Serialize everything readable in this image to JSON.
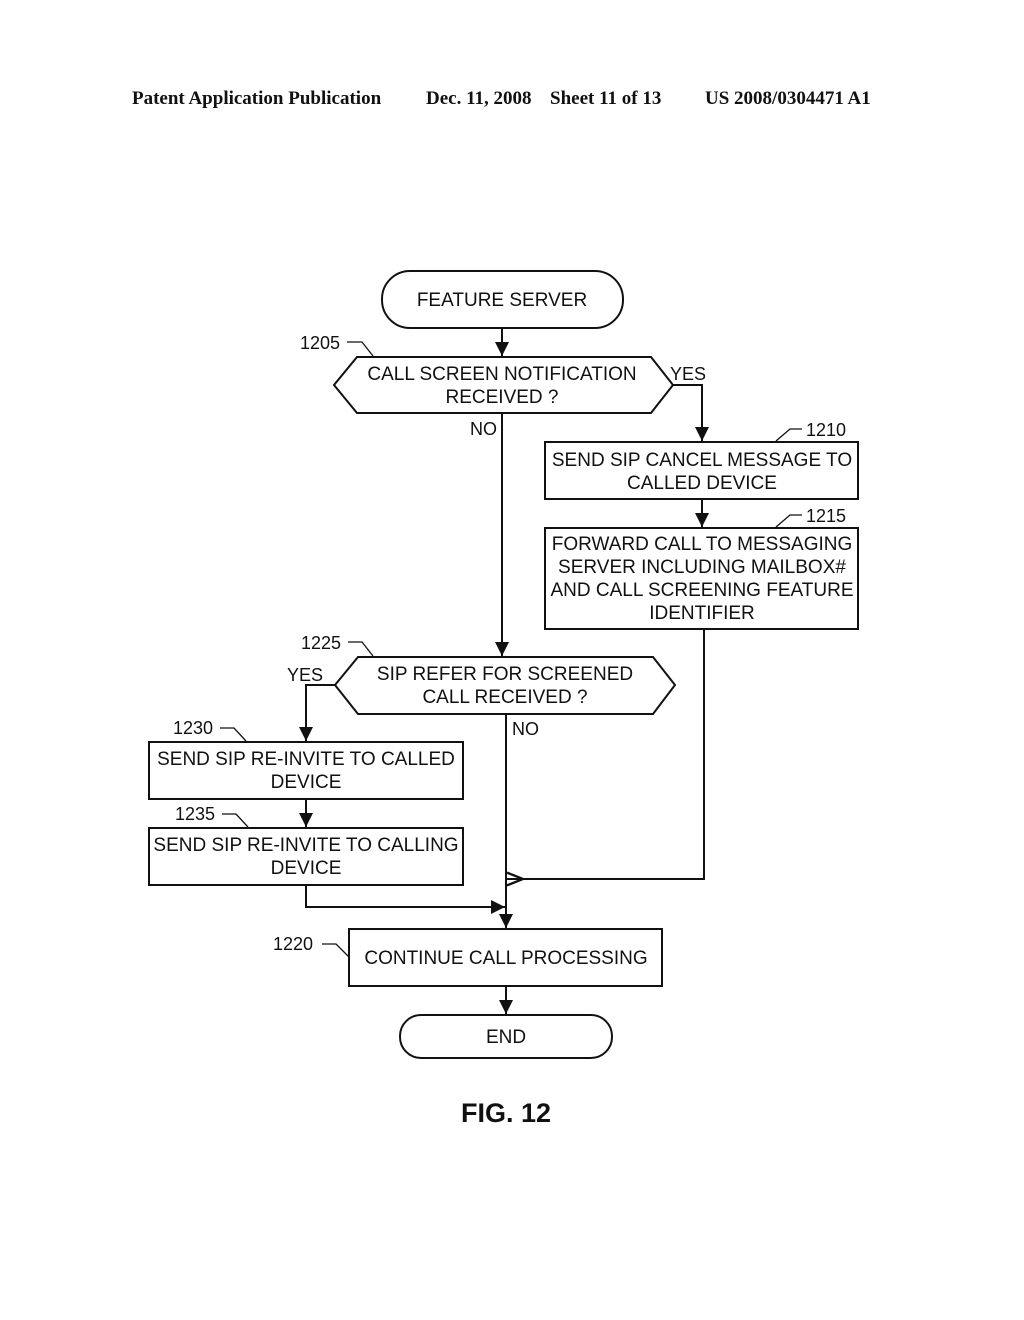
{
  "header": {
    "publication": "Patent Application Publication",
    "date": "Dec. 11, 2008",
    "sheet": "Sheet 11 of 13",
    "number": "US 2008/0304471 A1"
  },
  "diagram": {
    "start": {
      "label": "FEATURE SERVER"
    },
    "decision_1205": {
      "ref": "1205",
      "lines": [
        "CALL SCREEN NOTIFICATION",
        "RECEIVED ?"
      ],
      "yes": "YES",
      "no": "NO"
    },
    "step_1210": {
      "ref": "1210",
      "lines": [
        "SEND SIP CANCEL MESSAGE TO",
        "CALLED DEVICE"
      ]
    },
    "step_1215": {
      "ref": "1215",
      "lines": [
        "FORWARD CALL TO MESSAGING",
        "SERVER INCLUDING MAILBOX#",
        "AND CALL SCREENING FEATURE",
        "IDENTIFIER"
      ]
    },
    "decision_1225": {
      "ref": "1225",
      "lines": [
        "SIP REFER FOR SCREENED",
        "CALL RECEIVED ?"
      ],
      "yes": "YES",
      "no": "NO"
    },
    "step_1230": {
      "ref": "1230",
      "lines": [
        "SEND SIP RE-INVITE TO CALLED",
        "DEVICE"
      ]
    },
    "step_1235": {
      "ref": "1235",
      "lines": [
        "SEND SIP RE-INVITE TO CALLING",
        "DEVICE"
      ]
    },
    "step_1220": {
      "ref": "1220",
      "lines": [
        "CONTINUE CALL PROCESSING"
      ]
    },
    "end": {
      "label": "END"
    }
  },
  "figure_label": "FIG. 12"
}
